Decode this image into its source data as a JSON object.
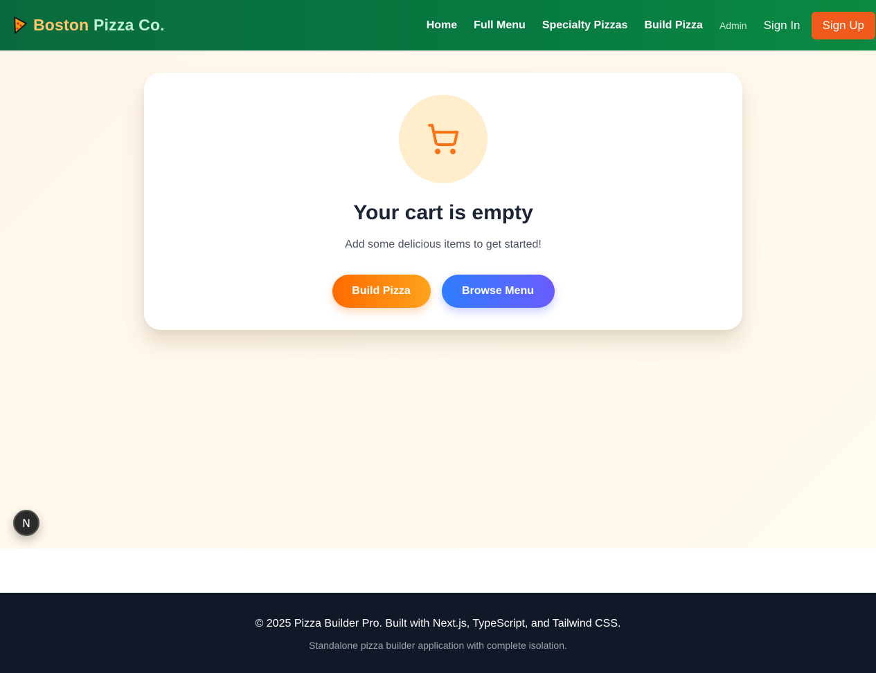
{
  "brand": {
    "part1": "Boston",
    "part2": "Pizza Co.",
    "logo_icon": "pizza-slice-icon"
  },
  "nav": {
    "links": [
      "Home",
      "Full Menu",
      "Specialty Pizzas",
      "Build Pizza"
    ],
    "admin": "Admin",
    "sign_in": "Sign In",
    "sign_up": "Sign Up"
  },
  "cart": {
    "icon": "shopping-cart-icon",
    "title": "Your cart is empty",
    "subtitle": "Add some delicious items to get started!",
    "build_button": "Build Pizza",
    "browse_button": "Browse Menu"
  },
  "dev_badge": {
    "label": "N"
  },
  "footer": {
    "copyright": "© 2025 Pizza Builder Pro. Built with Next.js, TypeScript, and Tailwind CSS.",
    "tagline": "Standalone pizza builder application with complete isolation."
  },
  "colors": {
    "nav_green": "#067a40",
    "signup_orange": "#f05a1a",
    "accent_orange": "#ff8a00",
    "accent_blue": "#2f7dff",
    "footer_bg": "#111827"
  }
}
